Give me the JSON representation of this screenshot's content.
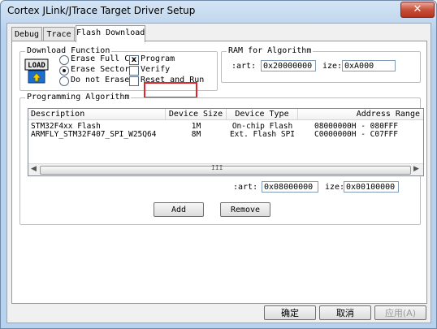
{
  "window": {
    "title": "Cortex JLink/JTrace Target Driver Setup",
    "close_glyph": "✕"
  },
  "tabs": [
    {
      "label": "Debug",
      "active": false
    },
    {
      "label": "Trace",
      "active": false
    },
    {
      "label": "Flash Download",
      "active": true
    }
  ],
  "download_function": {
    "title": "Download Function",
    "logo_top": "LOAD",
    "options": [
      {
        "label": "Erase Full C",
        "selected": false
      },
      {
        "label": "Erase Sector",
        "selected": true
      },
      {
        "label": "Do not Erase",
        "selected": false
      }
    ],
    "checks": [
      {
        "label": "Program",
        "checked": true,
        "mark": "x"
      },
      {
        "label": "Verify",
        "checked": false,
        "mark": ""
      },
      {
        "label": "Reset and Run",
        "checked": false,
        "mark": ""
      }
    ]
  },
  "ram": {
    "title": "RAM for Algorithm",
    "start_label": ":art:",
    "start_value": "0x20000000",
    "size_label": "ize:",
    "size_value": "0xA000"
  },
  "programming": {
    "title": "Programming Algorithm",
    "columns": [
      "Description",
      "Device Size",
      "Device Type",
      "Address Range"
    ],
    "rows": [
      [
        "STM32F4xx Flash",
        "1M",
        "On-chip Flash",
        "08000000H - 080FFF"
      ],
      [
        "ARMFLY_STM32F407_SPI_W25Q64",
        "8M",
        "Ext. Flash SPI",
        "C0000000H - C07FFF"
      ]
    ],
    "scroll_grip": "III",
    "start_label": ":art:",
    "start_value": "0x08000000",
    "size_label": "ize:",
    "size_value": "0x00100000",
    "add_label": "Add",
    "remove_label": "Remove"
  },
  "footer": {
    "ok_label": "确定",
    "cancel_label": "取消",
    "apply_label": "应用(A)"
  },
  "colors": {
    "highlight_box": "#e0262d",
    "titlebar": "#b8d1ec"
  }
}
